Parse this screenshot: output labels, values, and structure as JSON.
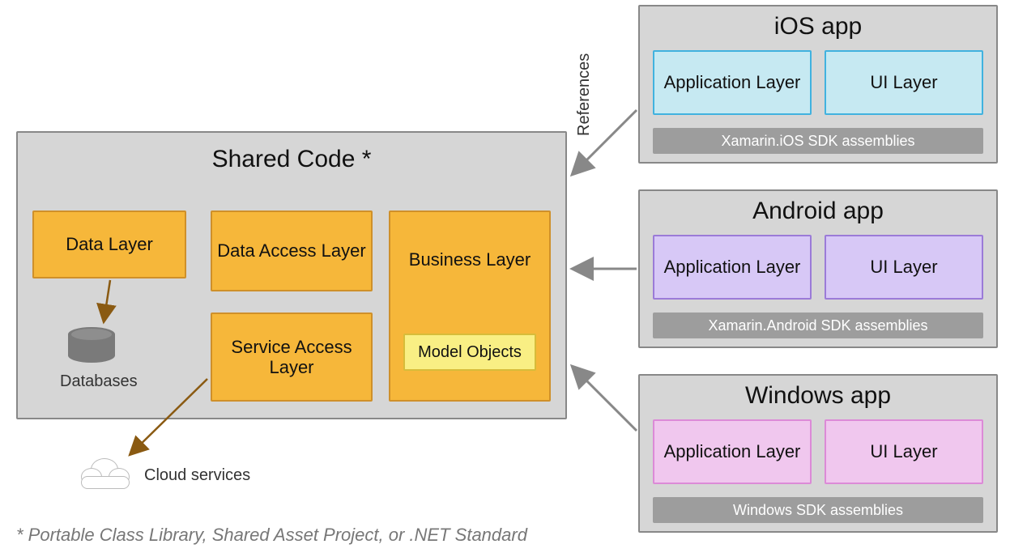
{
  "shared": {
    "title": "Shared Code *",
    "data_layer": "Data Layer",
    "data_access_layer": "Data Access Layer",
    "service_access_layer": "Service Access Layer",
    "business_layer": "Business Layer",
    "model_objects": "Model Objects",
    "databases_label": "Databases",
    "cloud_services_label": "Cloud services"
  },
  "apps": {
    "ios": {
      "title": "iOS app",
      "app_layer": "Application Layer",
      "ui_layer": "UI Layer",
      "sdk": "Xamarin.iOS SDK assemblies"
    },
    "android": {
      "title": "Android app",
      "app_layer": "Application Layer",
      "ui_layer": "UI Layer",
      "sdk": "Xamarin.Android SDK assemblies"
    },
    "windows": {
      "title": "Windows app",
      "app_layer": "Application Layer",
      "ui_layer": "UI Layer",
      "sdk": "Windows SDK assemblies"
    }
  },
  "references_label": "References",
  "footnote": "* Portable Class Library, Shared Asset Project, or .NET Standard",
  "colors": {
    "orange": "#f6b73a",
    "yellow": "#f9ef84",
    "blue": "#c6e9f2",
    "purple": "#d7c8f6",
    "pink": "#f0c7ee",
    "panel": "#d6d6d6"
  }
}
